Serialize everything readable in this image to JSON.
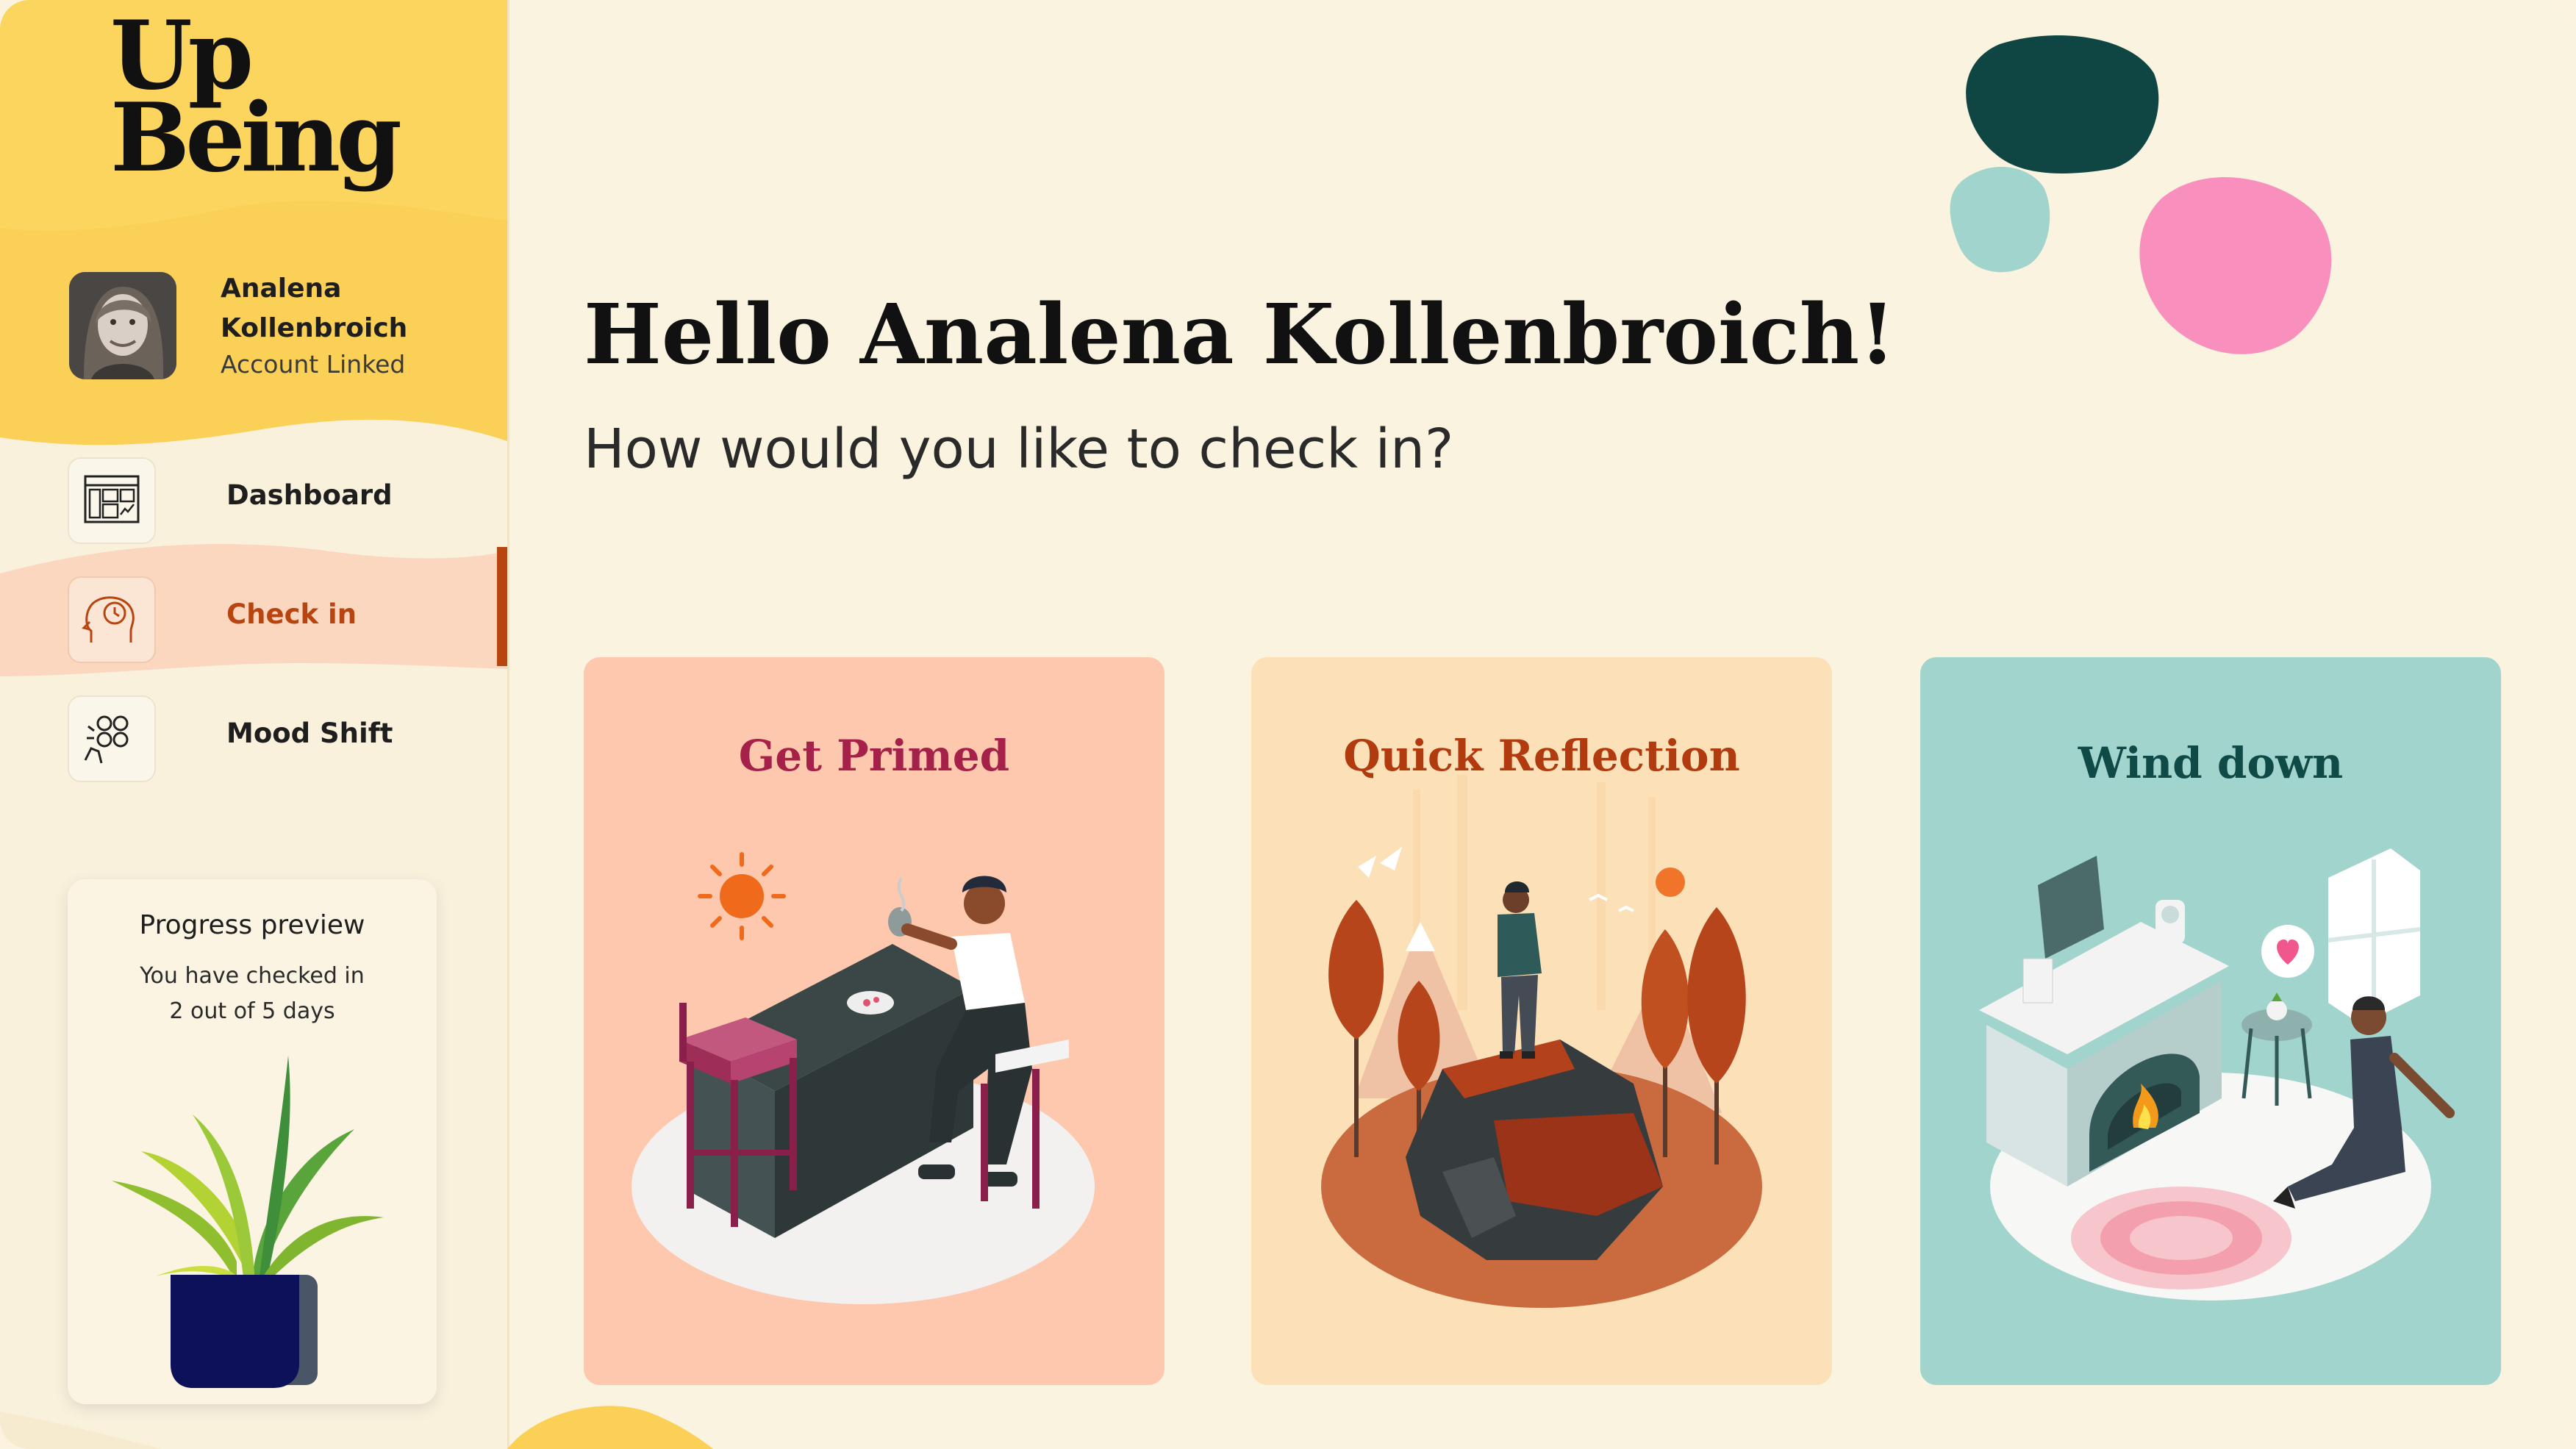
{
  "app": {
    "logo_line1": "Up",
    "logo_line2": "Being"
  },
  "user": {
    "name": "Analena Kollenbroich",
    "status": "Account Linked"
  },
  "nav": {
    "items": [
      {
        "label": "Dashboard",
        "icon": "dashboard-icon"
      },
      {
        "label": "Check in",
        "icon": "head-clock-icon"
      },
      {
        "label": "Mood Shift",
        "icon": "mood-faces-icon"
      }
    ],
    "active": "Check in"
  },
  "progress": {
    "title": "Progress preview",
    "text_line1": "You have checked in",
    "text_line2": "2 out of 5 days",
    "checked_days": 2,
    "total_days": 5
  },
  "main": {
    "greeting": "Hello Analena Kollenbroich!",
    "subtitle": "How would you like to check in?"
  },
  "cards": [
    {
      "title": "Get Primed",
      "bg": "#fdc8ad",
      "title_color": "#a5214a"
    },
    {
      "title": "Quick Reflection",
      "bg": "#fce1b8",
      "title_color": "#b23a0f"
    },
    {
      "title": "Wind down",
      "bg": "#a1d4cd",
      "title_color": "#0f4a47"
    }
  ],
  "colors": {
    "accent": "#b8450f",
    "sidebar_yellow": "#fccf57",
    "active_nav_bg": "#fbd7c0"
  }
}
